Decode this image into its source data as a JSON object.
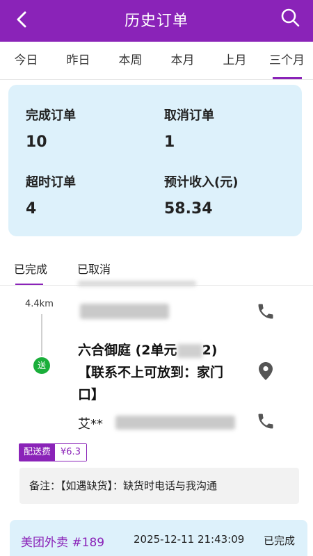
{
  "header": {
    "title": "历史订单"
  },
  "period_tabs": [
    "今日",
    "昨日",
    "本周",
    "本月",
    "上月",
    "三个月"
  ],
  "stats": {
    "completed_label": "完成订单",
    "completed_value": "10",
    "cancelled_label": "取消订单",
    "cancelled_value": "1",
    "overtime_label": "超时订单",
    "overtime_value": "4",
    "income_label": "预计收入(元)",
    "income_value": "58.34"
  },
  "order_tabs": [
    "已完成",
    "已取消"
  ],
  "order": {
    "distance": "4.4km",
    "send_badge": "送",
    "address": "六合御庭 (2单元",
    "address_suffix": "2)",
    "address_note": "【联系不上可放到：家门口】",
    "contact_name": "艾**",
    "fee_label": "配送费",
    "fee_value": "¥6.3",
    "remark": "备注：【如遇缺货】：缺货时电话与我沟通"
  },
  "next_order": {
    "platform": "美团外卖 #189",
    "time": "2025-12-11 21:43:09",
    "status": "已完成"
  },
  "colors": {
    "accent": "#8a23b8",
    "stats_bg": "#ddf1fb",
    "send_green": "#1aae3a"
  }
}
